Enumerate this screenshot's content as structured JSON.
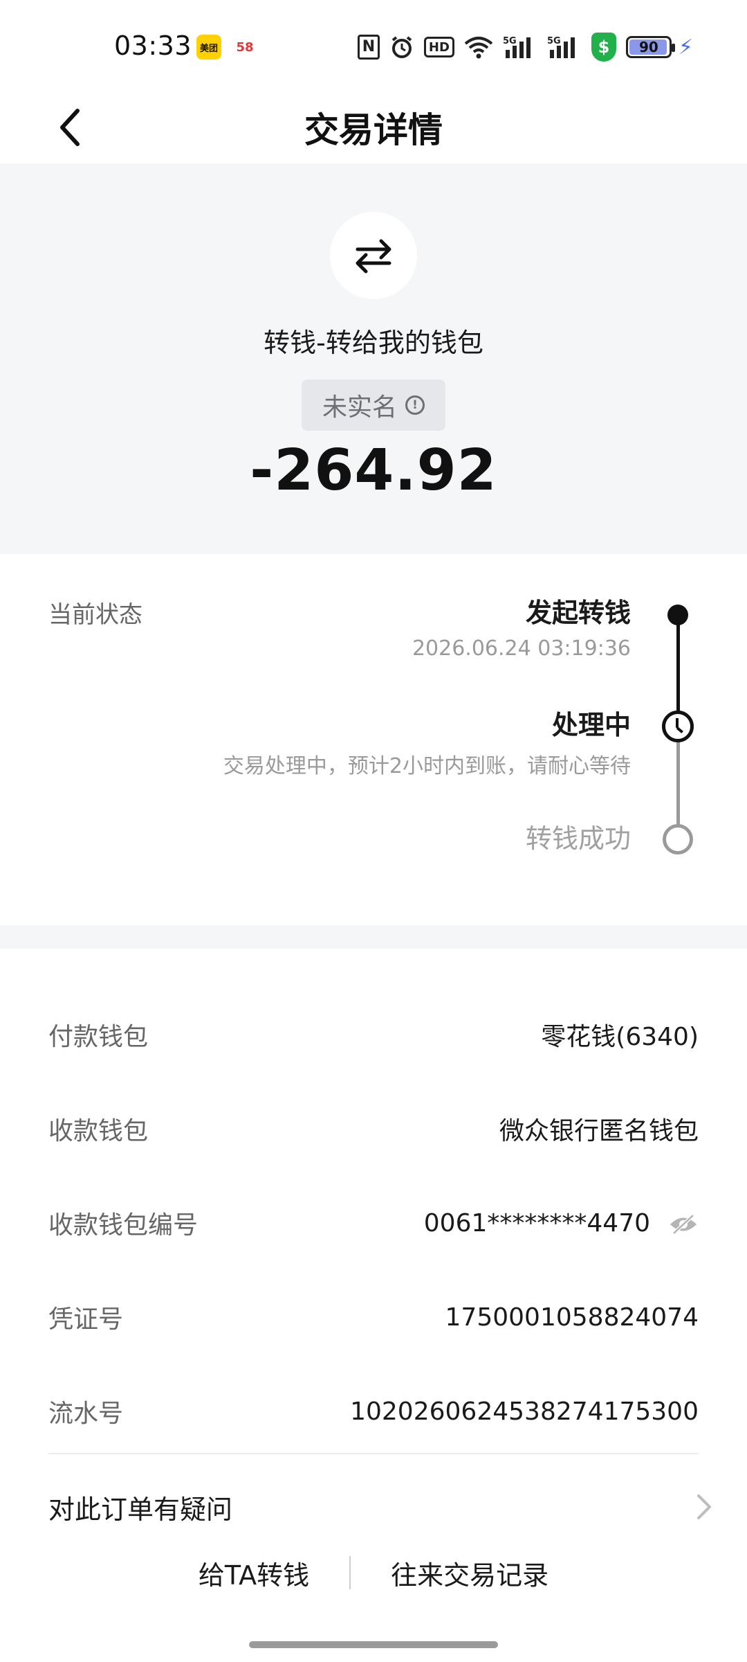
{
  "status_bar": {
    "time": "03:33",
    "app_icons": [
      "美团",
      "58"
    ],
    "battery_level": "90"
  },
  "header": {
    "title": "交易详情"
  },
  "summary": {
    "icon": "transfer-arrows-icon",
    "label": "转钱-转给我的钱包",
    "badge": "未实名",
    "amount": "-264.92"
  },
  "status": {
    "label": "当前状态",
    "steps": [
      {
        "title": "发起转钱",
        "subtitle": "2026.06.24 03:19:36",
        "state": "done"
      },
      {
        "title": "处理中",
        "subtitle": "交易处理中，预计2小时内到账，请耐心等待",
        "state": "current"
      },
      {
        "title": "转钱成功",
        "subtitle": "",
        "state": "pending"
      }
    ]
  },
  "details": [
    {
      "label": "付款钱包",
      "value": "零花钱(6340)"
    },
    {
      "label": "收款钱包",
      "value": "微众银行匿名钱包"
    },
    {
      "label": "收款钱包编号",
      "value": "0061********4470"
    },
    {
      "label": "凭证号",
      "value": "1750001058824074"
    },
    {
      "label": "流水号",
      "value": "1020260624538274175300"
    }
  ],
  "question": {
    "label": "对此订单有疑问"
  },
  "bottom_links": {
    "transfer": "给TA转钱",
    "history": "往来交易记录"
  },
  "colors": {
    "background_gray": "#f5f6f8",
    "text_primary": "#1a1a1a",
    "text_secondary": "#666666",
    "muted": "#9a9a9a"
  }
}
